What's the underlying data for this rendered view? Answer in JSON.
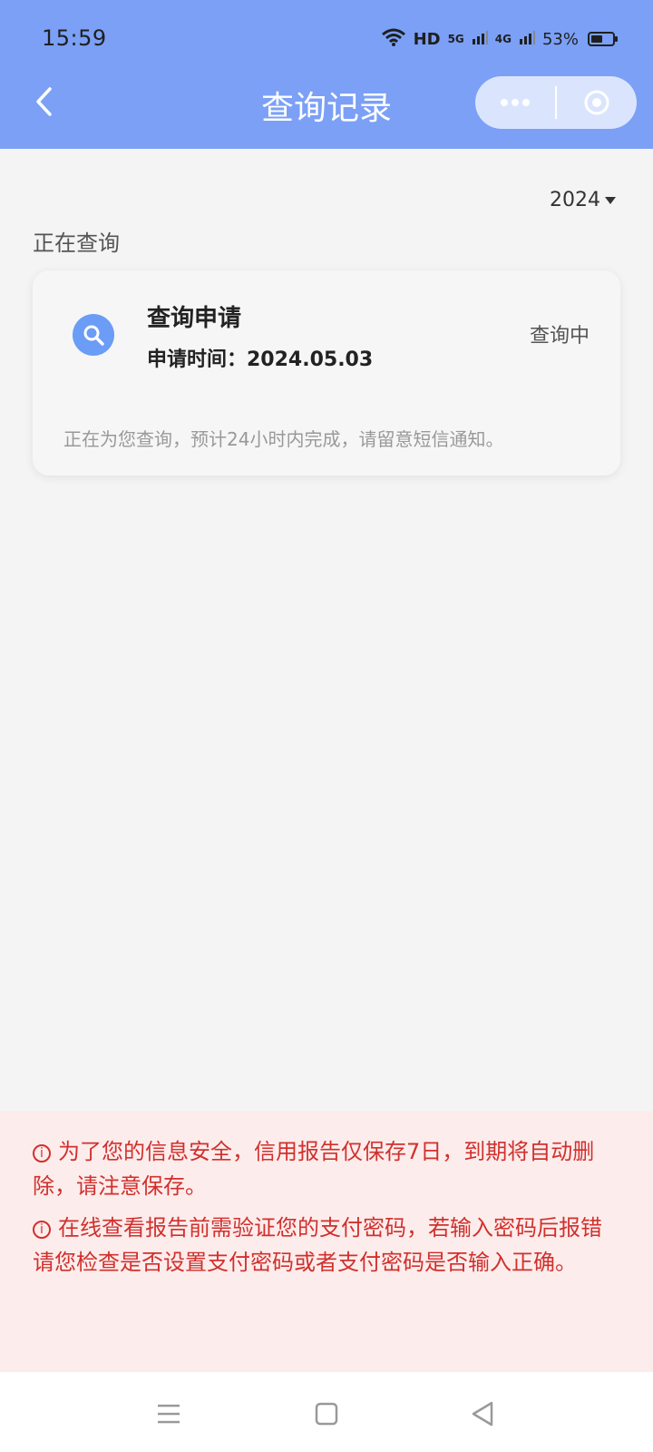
{
  "status_bar": {
    "time": "15:59",
    "network": "HD",
    "signal1": "5G",
    "signal2": "4G",
    "battery_text": "53%",
    "battery_level": 0.53
  },
  "nav": {
    "title": "查询记录",
    "back_icon": "chevron-left-icon",
    "more_icon": "more-dots-icon",
    "close_icon": "close-circle-icon"
  },
  "filter": {
    "year": "2024"
  },
  "section": {
    "label": "正在查询"
  },
  "record": {
    "title": "查询申请",
    "time_label": "申请时间：2024.05.03",
    "status": "查询中",
    "note": "正在为您查询，预计24小时内完成，请留意短信通知。",
    "icon": "search-icon"
  },
  "notices": [
    "为了您的信息安全，信用报告仅保存7日，到期将自动删除，请注意保存。",
    "在线查看报告前需验证您的支付密码，若输入密码后报错请您检查是否设置支付密码或者支付密码是否输入正确。"
  ],
  "colors": {
    "header": "#7ba0f6",
    "notice_bg": "#fdecec",
    "notice_text": "#d0312d",
    "accent": "#6b9cf6"
  }
}
